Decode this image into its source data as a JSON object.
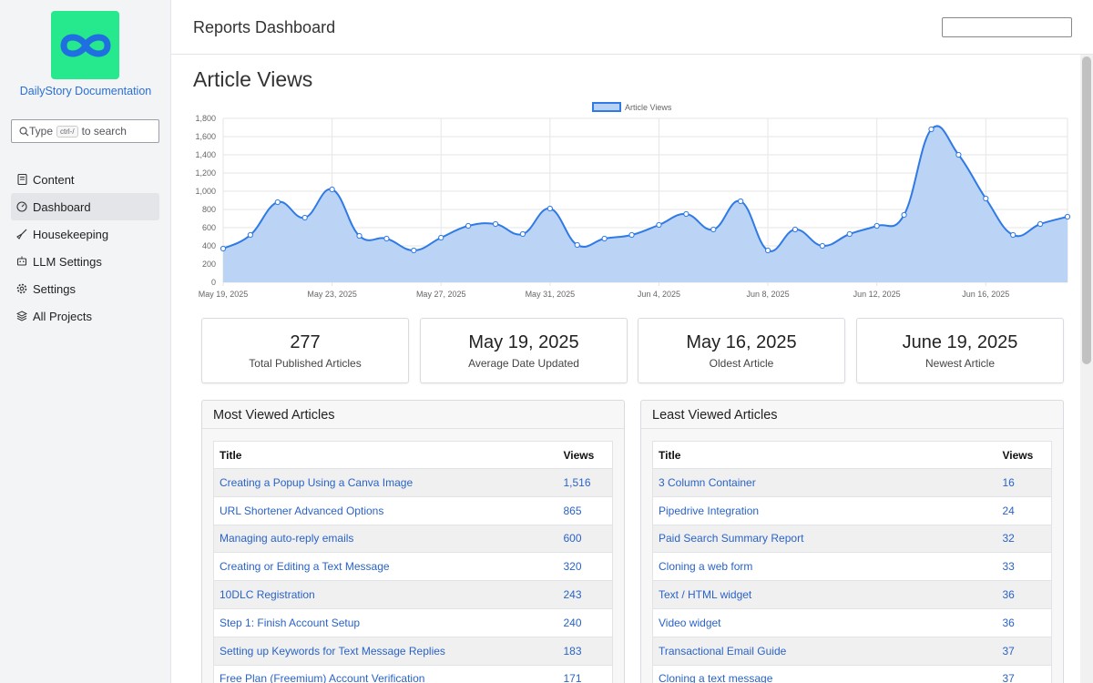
{
  "sidebar": {
    "brand": "DailyStory Documentation",
    "search": {
      "prefix": "Type",
      "kbd": "ctrl-/",
      "suffix": "to search"
    },
    "items": [
      {
        "label": "Content",
        "icon": "book-icon",
        "active": false
      },
      {
        "label": "Dashboard",
        "icon": "gauge-icon",
        "active": true
      },
      {
        "label": "Housekeeping",
        "icon": "broom-icon",
        "active": false
      },
      {
        "label": "LLM Settings",
        "icon": "robot-icon",
        "active": false
      },
      {
        "label": "Settings",
        "icon": "gear-icon",
        "active": false
      },
      {
        "label": "All Projects",
        "icon": "layers-icon",
        "active": false
      }
    ]
  },
  "header": {
    "title": "Reports Dashboard",
    "search_value": ""
  },
  "page_title": "Article Views",
  "chart_data": {
    "type": "area",
    "legend": "Article Views",
    "legend_position": "top-center",
    "x": [
      "May 19, 2025",
      "May 20, 2025",
      "May 21, 2025",
      "May 22, 2025",
      "May 23, 2025",
      "May 24, 2025",
      "May 25, 2025",
      "May 26, 2025",
      "May 27, 2025",
      "May 28, 2025",
      "May 29, 2025",
      "May 30, 2025",
      "May 31, 2025",
      "Jun 1, 2025",
      "Jun 2, 2025",
      "Jun 3, 2025",
      "Jun 4, 2025",
      "Jun 5, 2025",
      "Jun 6, 2025",
      "Jun 7, 2025",
      "Jun 8, 2025",
      "Jun 9, 2025",
      "Jun 10, 2025",
      "Jun 11, 2025",
      "Jun 12, 2025",
      "Jun 13, 2025",
      "Jun 14, 2025",
      "Jun 15, 2025",
      "Jun 16, 2025",
      "Jun 17, 2025",
      "Jun 18, 2025",
      "Jun 19, 2025"
    ],
    "x_tick_labels": [
      "May 19, 2025",
      "May 23, 2025",
      "May 27, 2025",
      "May 31, 2025",
      "Jun 4, 2025",
      "Jun 8, 2025",
      "Jun 12, 2025",
      "Jun 16, 2025"
    ],
    "values": [
      370,
      520,
      880,
      710,
      1020,
      510,
      480,
      350,
      490,
      620,
      640,
      530,
      810,
      410,
      480,
      520,
      630,
      750,
      580,
      890,
      350,
      580,
      400,
      530,
      620,
      740,
      1680,
      1400,
      920,
      520,
      640,
      720
    ],
    "y_ticks": [
      "0",
      "200",
      "400",
      "600",
      "800",
      "1,000",
      "1,200",
      "1,400",
      "1,600",
      "1,800"
    ],
    "ylim": [
      0,
      1800
    ],
    "grid": true,
    "line_color": "#2f7ae5",
    "fill_color": "#b7d2f4"
  },
  "stats": [
    {
      "value": "277",
      "label": "Total Published Articles"
    },
    {
      "value": "May 19, 2025",
      "label": "Average Date Updated"
    },
    {
      "value": "May 16, 2025",
      "label": "Oldest Article"
    },
    {
      "value": "June 19, 2025",
      "label": "Newest Article"
    }
  ],
  "most_viewed": {
    "title": "Most Viewed Articles",
    "headers": [
      "Title",
      "Views"
    ],
    "rows": [
      [
        "Creating a Popup Using a Canva Image",
        "1,516"
      ],
      [
        "URL Shortener Advanced Options",
        "865"
      ],
      [
        "Managing auto-reply emails",
        "600"
      ],
      [
        "Creating or Editing a Text Message",
        "320"
      ],
      [
        "10DLC Registration",
        "243"
      ],
      [
        "Step 1: Finish Account Setup",
        "240"
      ],
      [
        "Setting up Keywords for Text Message Replies",
        "183"
      ],
      [
        "Free Plan (Freemium) Account Verification",
        "171"
      ]
    ]
  },
  "least_viewed": {
    "title": "Least Viewed Articles",
    "headers": [
      "Title",
      "Views"
    ],
    "rows": [
      [
        "3 Column Container",
        "16"
      ],
      [
        "Pipedrive Integration",
        "24"
      ],
      [
        "Paid Search Summary Report",
        "32"
      ],
      [
        "Cloning a web form",
        "33"
      ],
      [
        "Text / HTML widget",
        "36"
      ],
      [
        "Video widget",
        "36"
      ],
      [
        "Transactional Email Guide",
        "37"
      ],
      [
        "Cloning a text message",
        "37"
      ]
    ]
  }
}
